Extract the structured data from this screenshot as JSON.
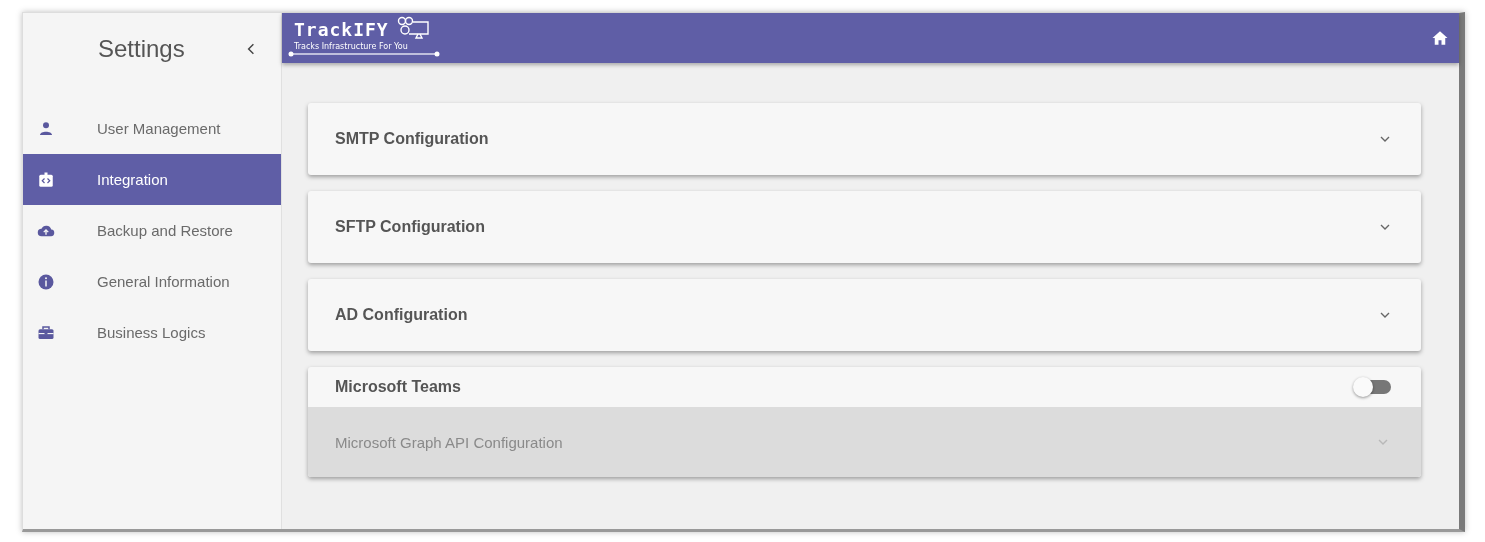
{
  "sidebar": {
    "title": "Settings",
    "items": [
      {
        "label": "User Management",
        "selected": false
      },
      {
        "label": "Integration",
        "selected": true
      },
      {
        "label": "Backup and Restore",
        "selected": false
      },
      {
        "label": "General Information",
        "selected": false
      },
      {
        "label": "Business Logics",
        "selected": false
      }
    ]
  },
  "header": {
    "logo": "TrackIFY",
    "tagline": "Tracks Infrastructure For You"
  },
  "panels": [
    {
      "kind": "accordion",
      "title": "SMTP Configuration",
      "expanded": false
    },
    {
      "kind": "accordion",
      "title": "SFTP Configuration",
      "expanded": false
    },
    {
      "kind": "accordion",
      "title": "AD Configuration",
      "expanded": false
    },
    {
      "kind": "toggle_group",
      "title": "Microsoft Teams",
      "on": false,
      "sub": {
        "title": "Microsoft Graph API Configuration",
        "disabled": true
      }
    }
  ]
}
